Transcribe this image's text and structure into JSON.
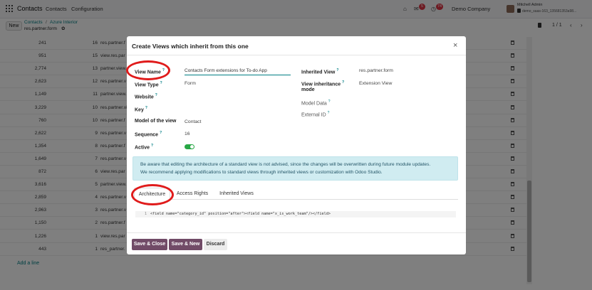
{
  "navbar": {
    "app_name": "Contacts",
    "menu": [
      "Contacts",
      "Configuration"
    ],
    "badge_chat": "5",
    "badge_activity": "74",
    "company": "Demo Company",
    "user_name": "Mitchell Admin",
    "user_db": "demo_saas-163_135681353a98..."
  },
  "control": {
    "new_label": "New",
    "breadcrumb_parent": "Contacts",
    "breadcrumb_sep": "/",
    "breadcrumb_current": "Azure Interior",
    "record": "res.partner.form",
    "pager": "1 / 1"
  },
  "list": {
    "rows": [
      {
        "id": "241",
        "seq": "16",
        "model": "res.partner.f"
      },
      {
        "id": "951",
        "seq": "15",
        "model": "view.res.par"
      },
      {
        "id": "2,774",
        "seq": "13",
        "model": "partner.view."
      },
      {
        "id": "2,623",
        "seq": "12",
        "model": "res.partner.v"
      },
      {
        "id": "1,149",
        "seq": "11",
        "model": "partner.view."
      },
      {
        "id": "3,229",
        "seq": "10",
        "model": "res.partner.vi"
      },
      {
        "id": "760",
        "seq": "10",
        "model": "res.partner.f"
      },
      {
        "id": "2,622",
        "seq": "9",
        "model": "res.partner.v"
      },
      {
        "id": "1,354",
        "seq": "8",
        "model": "res.partner.f"
      },
      {
        "id": "1,649",
        "seq": "7",
        "model": "res.partner.v"
      },
      {
        "id": "872",
        "seq": "6",
        "model": "view.res.par"
      },
      {
        "id": "3,616",
        "seq": "5",
        "model": "partner.view."
      },
      {
        "id": "2,859",
        "seq": "4",
        "model": "res.partner.v"
      },
      {
        "id": "2,963",
        "seq": "3",
        "model": "res.partner.v"
      },
      {
        "id": "1,150",
        "seq": "2",
        "model": "res.partner.f"
      },
      {
        "id": "1,226",
        "seq": "1",
        "model": "view.res.par"
      },
      {
        "id": "443",
        "seq": "1",
        "model": "res_partner."
      }
    ],
    "add_line": "Add a line"
  },
  "modal": {
    "title": "Create Views which inherit from this one",
    "close": "×",
    "labels": {
      "view_name": "View Name",
      "view_type": "View Type",
      "website": "Website",
      "key": "Key",
      "model": "Model of the view",
      "sequence": "Sequence",
      "active": "Active",
      "inherited_view": "Inherited View",
      "inheritance_mode_1": "View inheritance",
      "inheritance_mode_2": "mode",
      "model_data": "Model Data",
      "external_id": "External ID"
    },
    "values": {
      "view_name": "Contacts Form extensions for To-do App",
      "view_type": "Form",
      "model": "Contact",
      "sequence": "16",
      "inherited_view": "res.partner.form",
      "inheritance_mode": "Extension View"
    },
    "help_mark": "?",
    "alert_line1": "Be aware that editing the architecture of a standard view is not advised, since the changes will be overwritten during future module updates.",
    "alert_line2": "We recommend applying modifications to standard views through inherited views or customization with Odoo Studio.",
    "tabs": [
      "Architecture",
      "Access Rights",
      "Inherited Views"
    ],
    "code_line_no": "1",
    "code_line": "<field name=\"category_id\" position=\"after\"><field name=\"x_is_work_team\"/></field>",
    "buttons": {
      "save_close": "Save & Close",
      "save_new": "Save & New",
      "discard": "Discard"
    }
  },
  "colors": {
    "accent": "#714b67",
    "link": "#017e84",
    "highlight_ring": "#e01b1b",
    "toggle_on": "#28a745"
  }
}
